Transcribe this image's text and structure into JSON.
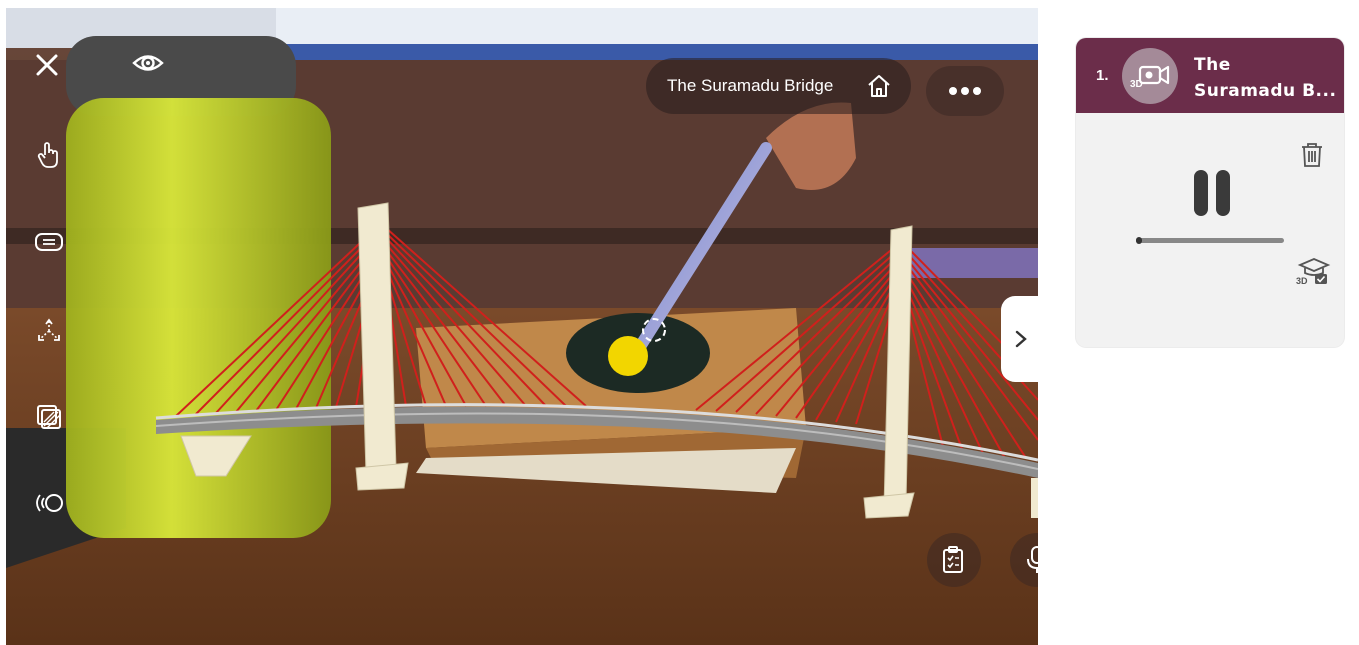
{
  "ar": {
    "title": "The Suramadu Bridge"
  },
  "panel": {
    "items": [
      {
        "index": "1.",
        "title_line1": "The",
        "title_line2": "Suramadu B..."
      }
    ],
    "playback": {
      "state": "playing",
      "progress": 0.01
    }
  },
  "colors": {
    "panel_header": "#6b2d4a",
    "cable": "#d0201c",
    "tower": "#f1ead0",
    "ball": "#f2d600"
  },
  "icons": {
    "close": "close-icon",
    "eye": "eye-icon",
    "hand": "hand-pointer-icon",
    "caption": "caption-icon",
    "move": "move-arrows-icon",
    "layers": "layers-icon",
    "sound": "sound-waves-icon",
    "home": "home-icon",
    "more": "more-dots-icon",
    "chevron": "chevron-right-icon",
    "quiz": "clipboard-quiz-icon",
    "mic": "microphone-icon",
    "video3d": "3d-video-icon",
    "trash": "trash-icon",
    "grad": "3d-graduation-icon"
  }
}
